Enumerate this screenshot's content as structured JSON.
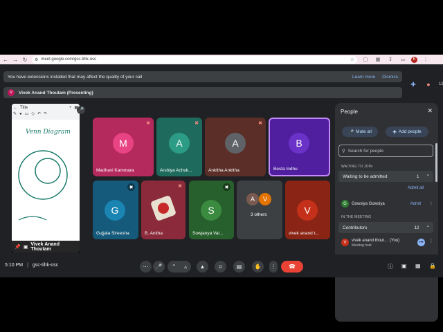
{
  "browser": {
    "url": "meet.google.com/gsc-tihk-osc",
    "profile_initial": "K"
  },
  "banners": {
    "extension_warning": "You have extensions installed that may affect the quality of your call",
    "learn_more": "Learn more",
    "dismiss": "Dismiss",
    "presenter_initial": "V",
    "presenter_text": "Vivek Anand Thoutam (Presenting)"
  },
  "top_right": {
    "participant_count": "12"
  },
  "presentation": {
    "title_placeholder": "Title",
    "presenter_name": "Vivek Anand Thoutam",
    "whiteboard_text": "Venn Diagram"
  },
  "tiles": [
    {
      "initial": "M",
      "name": "Madhavi Kammara",
      "bg": "#b52a5c",
      "avatar": "#e84382"
    },
    {
      "initial": "A",
      "name": "Arshiya Achuk...",
      "bg": "#1e6b5e",
      "avatar": "#2c9c86"
    },
    {
      "initial": "A",
      "name": "Ankitha Ankitha",
      "bg": "#5b2e28",
      "avatar": "#5f6368"
    },
    {
      "initial": "B",
      "name": "Besta Indhu",
      "bg": "#4f1fa0",
      "avatar": "#6b32c8"
    },
    {
      "initial": "G",
      "name": "Gujjala Sireesha",
      "bg": "#155a7a",
      "avatar": "#1a85b3"
    },
    {
      "initial": "",
      "name": "B. Anitha",
      "bg": "#8a2a3a",
      "avatar": "#e8e0d0"
    },
    {
      "initial": "S",
      "name": "Sowjanya Val...",
      "bg": "#27602c",
      "avatar": "#3a8a3f"
    },
    {
      "initial": "",
      "name": "3 others",
      "bg": "#3c4043",
      "avatar": "#7a5a50"
    },
    {
      "initial": "V",
      "name": "vivek anand t...",
      "bg": "#8a2414",
      "avatar": "#c5301a"
    }
  ],
  "others_initials": [
    "A",
    "V"
  ],
  "people": {
    "title": "People",
    "mute_all": "Mute all",
    "add_people": "Add people",
    "search_placeholder": "Search for people",
    "waiting_label": "WAITING TO JOIN",
    "waiting_group": "Waiting to be admitted",
    "waiting_count": "1",
    "admit_all": "Admit all",
    "waiting_person": {
      "initial": "G",
      "name": "Gowsiya Gowsiya",
      "admit": "Admit"
    },
    "in_meeting_label": "IN THE MEETING",
    "contributors": "Contributors",
    "contributors_count": "12",
    "host": {
      "initial": "V",
      "name": "vivek anand thout...",
      "you": "(You)",
      "role": "Meeting host"
    }
  },
  "bottom": {
    "time": "5:10 PM",
    "meeting_code": "gsc-tihk-osc"
  },
  "colors": {
    "accent": "#8ab4f8",
    "hangup": "#ea4335",
    "panel": "#303134",
    "app_bg": "#202124"
  }
}
